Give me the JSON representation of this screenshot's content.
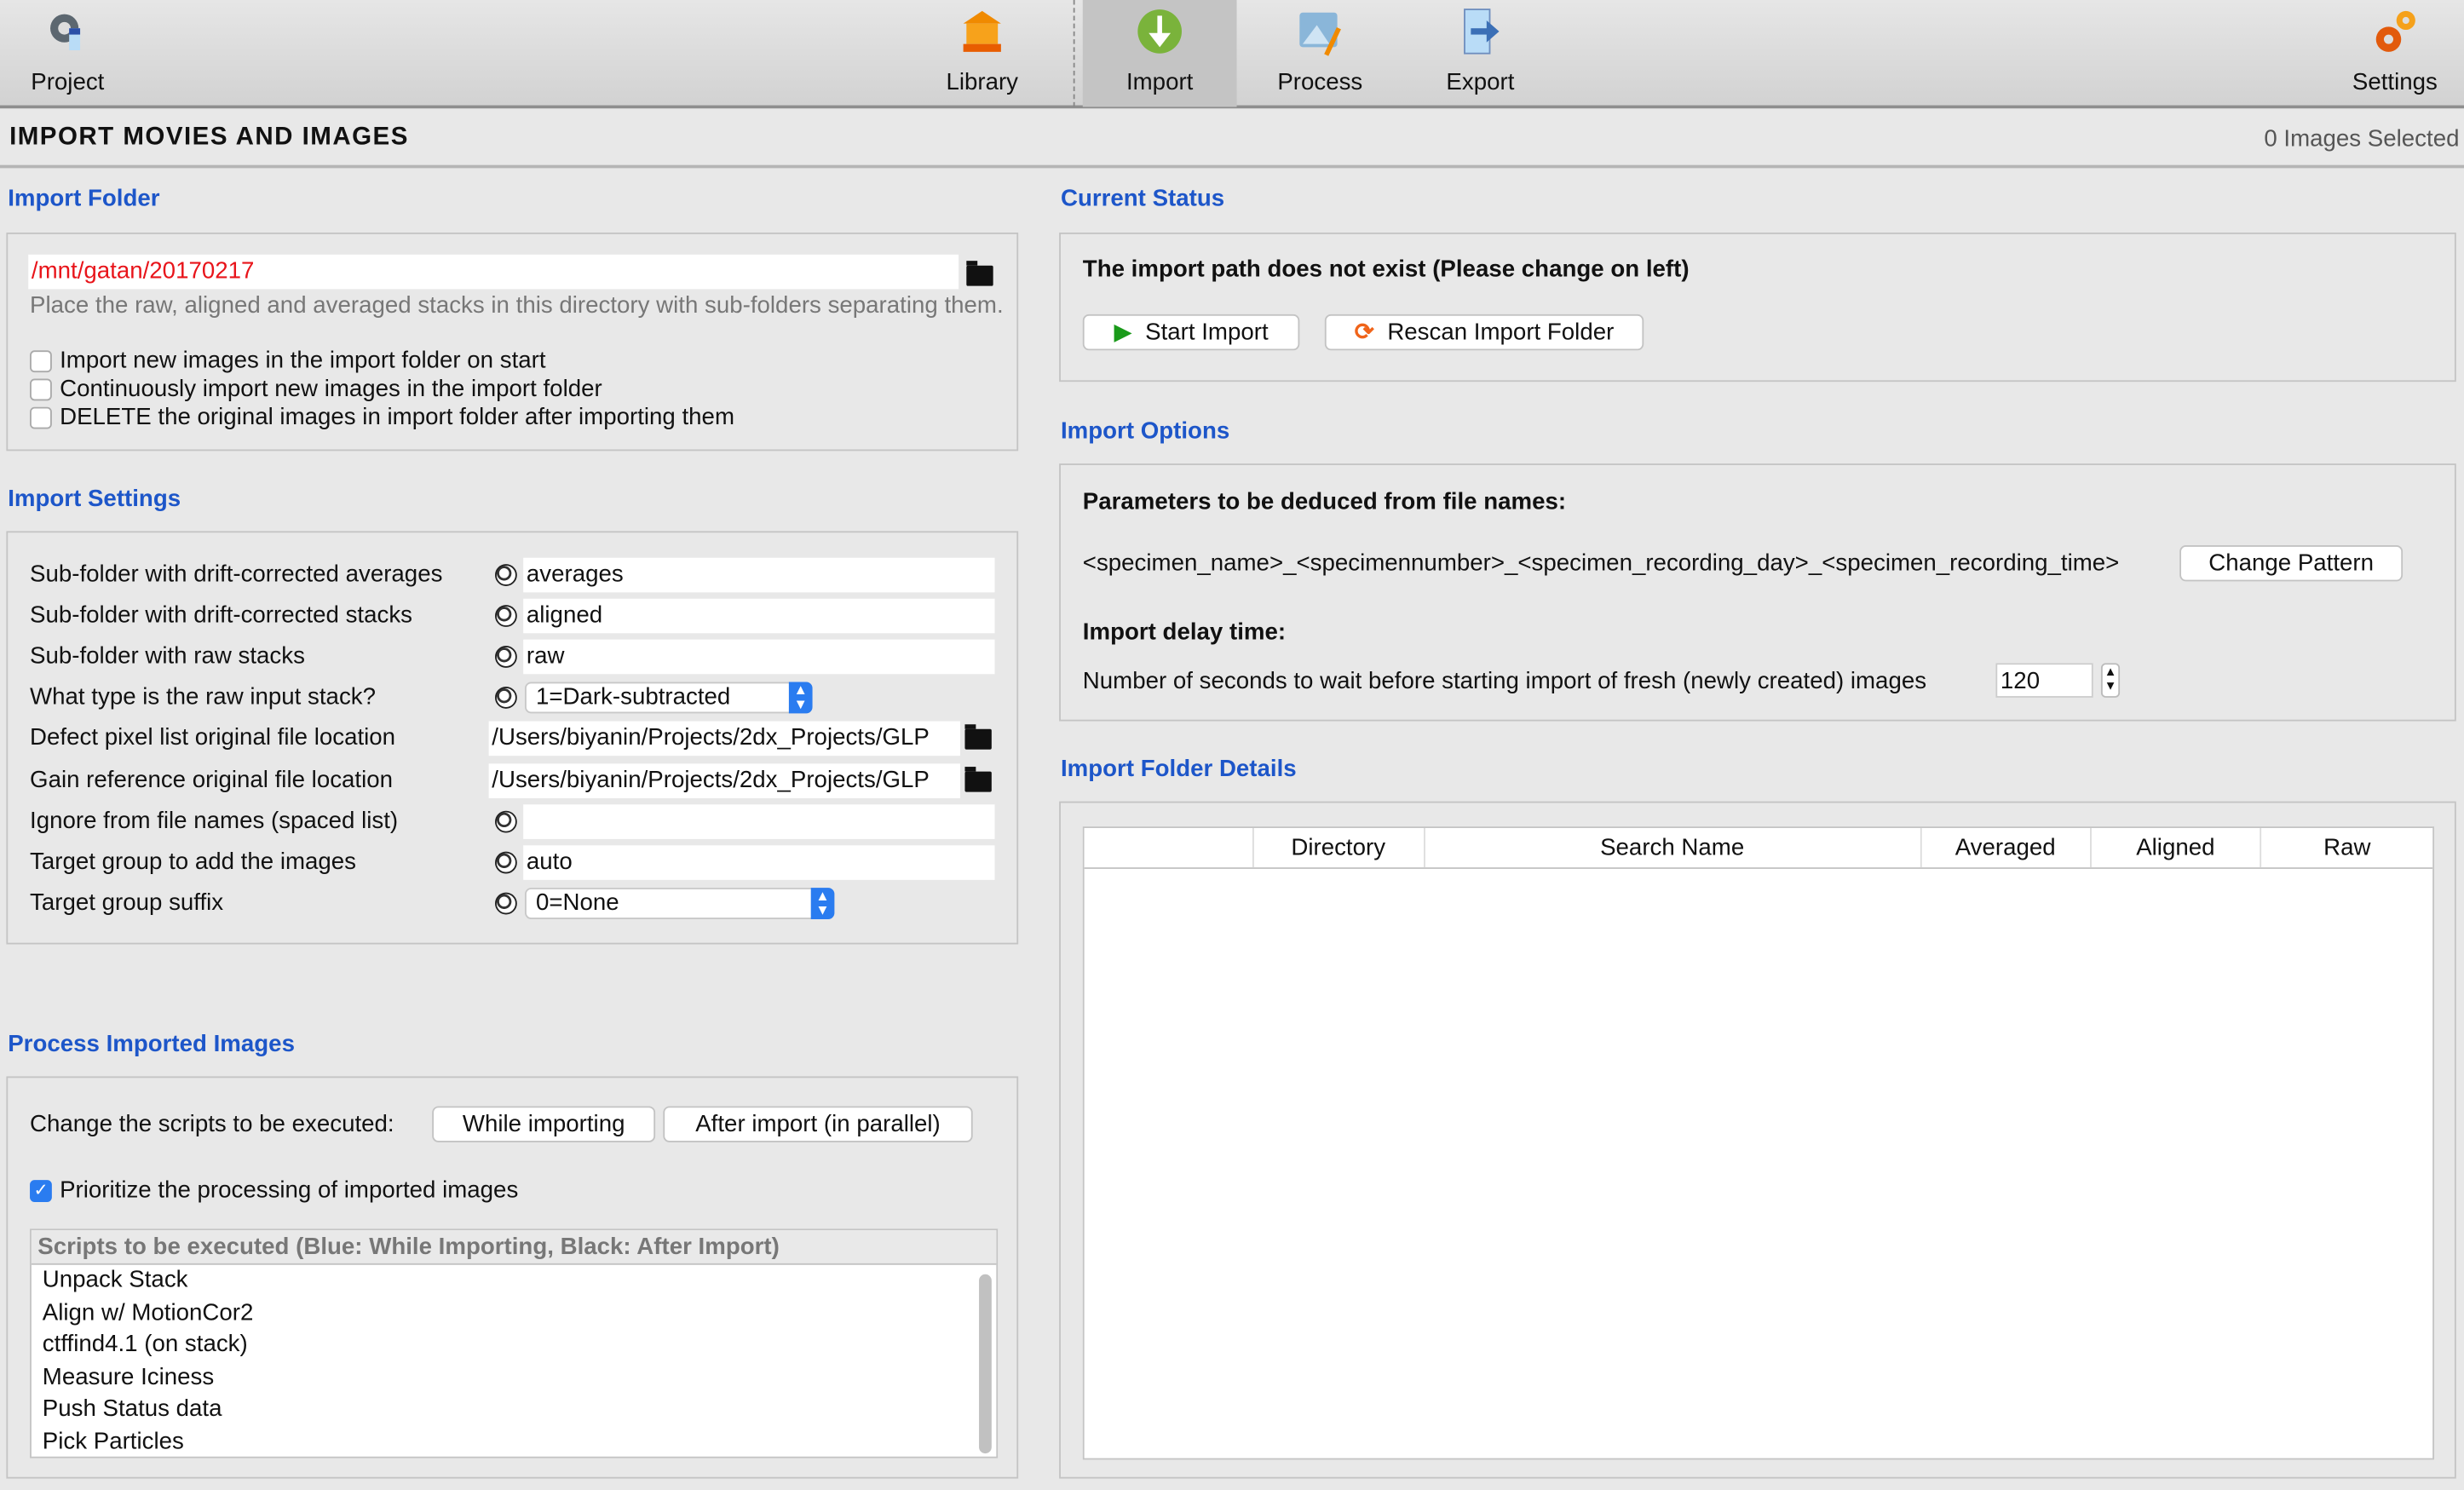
{
  "toolbar": {
    "items": [
      {
        "label": "Project",
        "icon": "project-gear-icon"
      },
      {
        "label": "Library",
        "icon": "library-icon"
      },
      {
        "label": "Import",
        "icon": "import-download-icon",
        "selected": true
      },
      {
        "label": "Process",
        "icon": "process-image-icon"
      },
      {
        "label": "Export",
        "icon": "export-icon"
      },
      {
        "label": "Settings",
        "icon": "settings-gears-icon"
      }
    ]
  },
  "header": {
    "title": "IMPORT MOVIES AND IMAGES",
    "selection": "0 Images Selected"
  },
  "import_folder": {
    "heading": "Import Folder",
    "path": "/mnt/gatan/20170217",
    "help": "Place the raw, aligned and averaged stacks in this directory with sub-folders separating them.",
    "options": [
      {
        "label": "Import new images in the import folder on start",
        "checked": false
      },
      {
        "label": "Continuously import new images in the import folder",
        "checked": false
      },
      {
        "label": "DELETE the original images in import folder after importing them",
        "checked": false
      }
    ]
  },
  "import_settings": {
    "heading": "Import Settings",
    "rows": [
      {
        "label": "Sub-folder with drift-corrected averages",
        "value": "averages",
        "kind": "text"
      },
      {
        "label": "Sub-folder with drift-corrected stacks",
        "value": "aligned",
        "kind": "text"
      },
      {
        "label": "Sub-folder with raw stacks",
        "value": "raw",
        "kind": "text"
      },
      {
        "label": "What type is the raw input stack?",
        "value": "1=Dark-subtracted",
        "kind": "select"
      },
      {
        "label": "Defect pixel list original file location",
        "value": "/Users/biyanin/Projects/2dx_Projects/GLP",
        "kind": "file"
      },
      {
        "label": "Gain reference original file location",
        "value": "/Users/biyanin/Projects/2dx_Projects/GLP",
        "kind": "file"
      },
      {
        "label": "Ignore from file names (spaced list)",
        "value": "",
        "kind": "text"
      },
      {
        "label": "Target group to add the images",
        "value": "auto",
        "kind": "text"
      },
      {
        "label": "Target group suffix",
        "value": "0=None",
        "kind": "select"
      }
    ]
  },
  "process": {
    "heading": "Process Imported Images",
    "change_label": "Change the scripts to be executed:",
    "while_btn": "While importing",
    "after_btn": "After import (in parallel)",
    "prioritize": "Prioritize the processing of imported images",
    "prioritize_checked": true,
    "list_header": "Scripts to be executed (Blue: While Importing, Black: After Import)",
    "scripts": [
      "Unpack Stack",
      "Align w/ MotionCor2",
      "ctffind4.1 (on stack)",
      "Measure Iciness",
      "Push Status data",
      "Pick Particles"
    ]
  },
  "status": {
    "heading": "Current Status",
    "message": "The import path does not exist (Please change on left)",
    "start": "Start Import",
    "rescan": "Rescan Import Folder"
  },
  "options": {
    "heading": "Import Options",
    "params_title": "Parameters to be deduced from file names:",
    "pattern": "<specimen_name>_<specimennumber>_<specimen_recording_day>_<specimen_recording_time>",
    "change_pattern": "Change Pattern",
    "delay_title": "Import delay time:",
    "delay_label": "Number of seconds to wait before starting import of fresh (newly created) images",
    "delay_value": "120"
  },
  "details": {
    "heading": "Import Folder Details",
    "columns": [
      "",
      "Directory",
      "Search Name",
      "Averaged",
      "Aligned",
      "Raw"
    ]
  },
  "colors": {
    "heading": "#1d56c9",
    "path_error": "#e8141a",
    "accent": "#2a7cf0"
  }
}
